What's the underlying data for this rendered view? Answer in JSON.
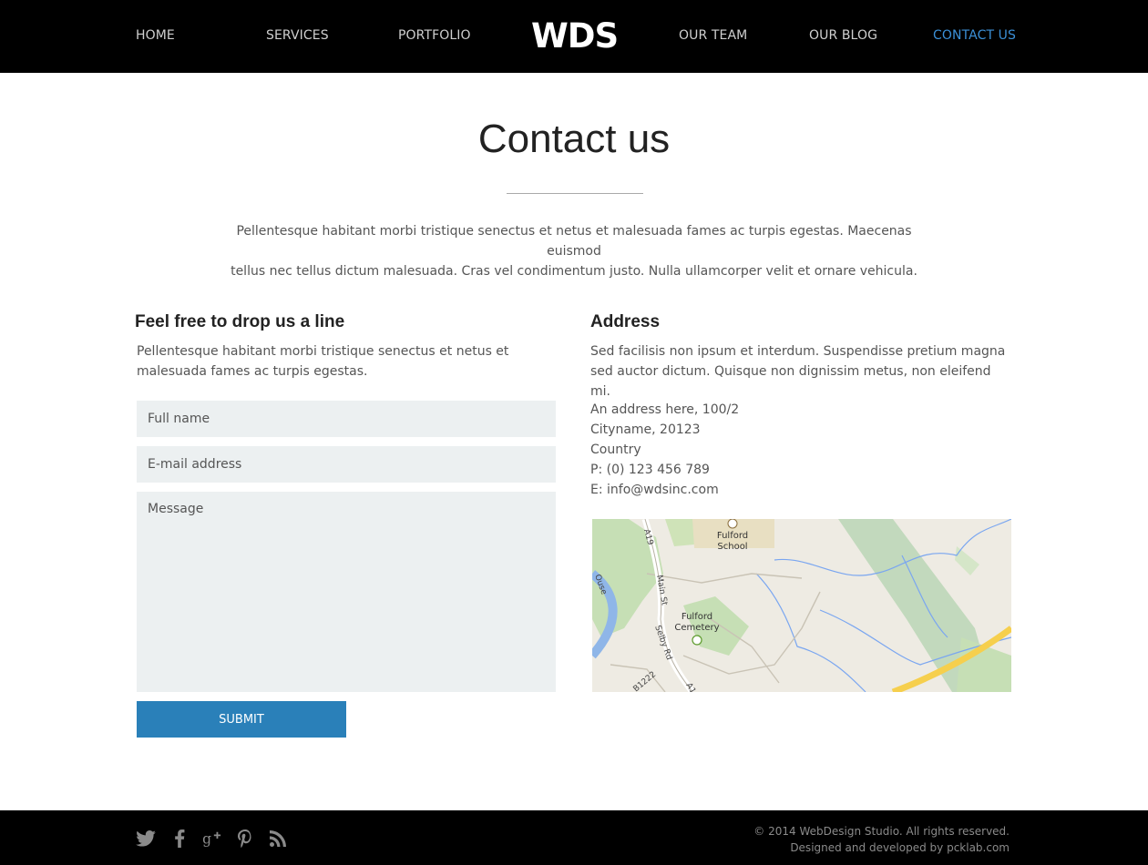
{
  "nav": {
    "items": [
      {
        "label": "HOME"
      },
      {
        "label": "SERVICES"
      },
      {
        "label": "PORTFOLIO"
      },
      {
        "label": "OUR TEAM"
      },
      {
        "label": "OUR BLOG"
      },
      {
        "label": "CONTACT US",
        "active": true
      }
    ],
    "logo": "WDS",
    "accent_color": "#3b8fd6"
  },
  "hero": {
    "title": "Contact us",
    "intro_line1": "Pellentesque habitant morbi tristique senectus et netus et malesuada fames ac turpis egestas. Maecenas euismod",
    "intro_line2": "tellus nec tellus dictum malesuada. Cras vel condimentum justo. Nulla ullamcorper velit et ornare vehicula."
  },
  "form_section": {
    "heading": "Feel free to drop us a line",
    "text": "Pellentesque habitant morbi tristique senectus et netus et malesuada fames ac turpis egestas.",
    "fields": {
      "full_name_placeholder": "Full name",
      "email_placeholder": "E-mail address",
      "message_placeholder": "Message"
    },
    "submit_label": "SUBMIT",
    "submit_color": "#2a80b9"
  },
  "address_section": {
    "heading": "Address",
    "text": "Sed facilisis non ipsum et interdum. Suspendisse pretium magna sed auctor dictum. Quisque non dignissim metus, non eleifend mi.",
    "lines": [
      "An address here, 100/2",
      "Cityname, 20123",
      "Country",
      "P: (0) 123 456 789",
      "E: info@wdsinc.com"
    ]
  },
  "map": {
    "labels": {
      "school_line1": "Fulford",
      "school_line2": "School",
      "cemetery_line1": "Fulford",
      "cemetery_line2": "Cemetery",
      "road_a19": "A19",
      "main_st": "Main St",
      "selby_rd": "Selby Rd",
      "ouse": "Ouse",
      "b1222": "B1222",
      "a1_partial": "A1"
    }
  },
  "footer": {
    "social_icons": [
      "twitter-icon",
      "facebook-icon",
      "google-plus-icon",
      "pinterest-icon",
      "rss-icon"
    ],
    "copyright": "© 2014 WebDesign Studio. All rights reserved.",
    "credits": "Designed and developed by pcklab.com"
  }
}
